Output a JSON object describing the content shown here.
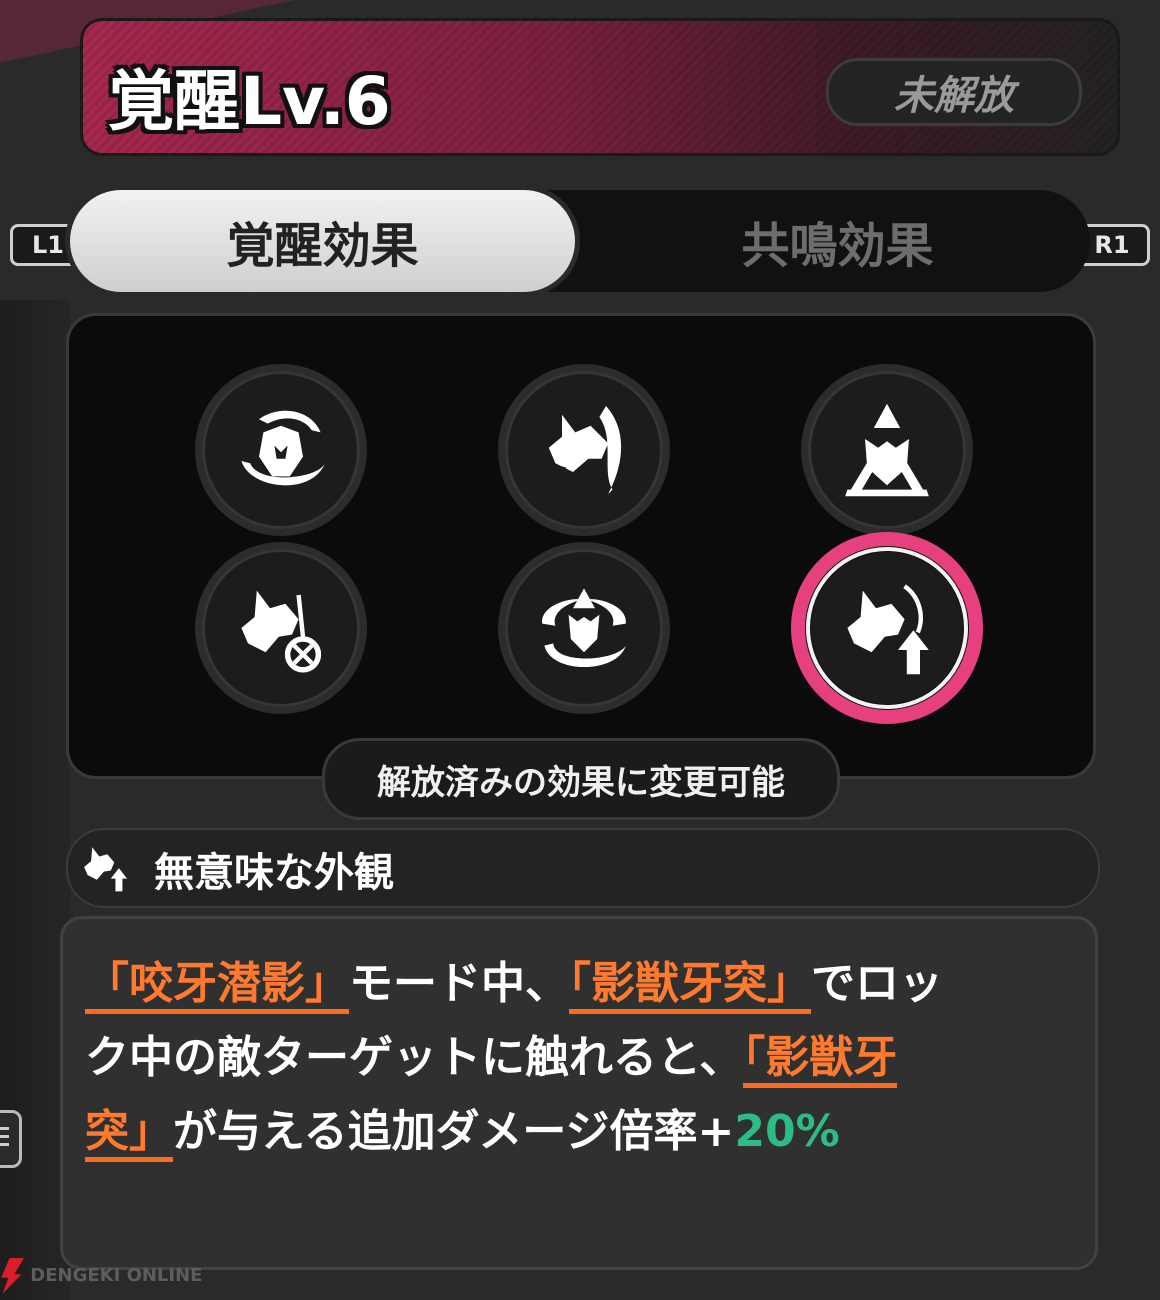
{
  "header": {
    "title": "覚醒Lv.6",
    "status": "未解放"
  },
  "tabs": [
    {
      "label": "覚醒効果",
      "active": true
    },
    {
      "label": "共鳴効果",
      "active": false
    }
  ],
  "keys": {
    "left": "L1",
    "right": "R1"
  },
  "nodes": [
    {
      "icon": "wolf-mask-orbit-icon"
    },
    {
      "icon": "wolf-head-claw-icon"
    },
    {
      "icon": "wolf-triangle-icon"
    },
    {
      "icon": "wolf-target-icon"
    },
    {
      "icon": "wolf-vortex-icon"
    },
    {
      "icon": "wolf-arrow-up-icon",
      "selected": true
    }
  ],
  "hint": "解放済みの効果に変更可能",
  "effect": {
    "name": "無意味な外観",
    "desc_parts": [
      "「咬牙潜影」",
      "モード中、",
      "「影獣牙突」",
      "でロッ",
      "ク中の敵ターゲットに触れると、",
      "「影獣牙",
      "突」",
      "が与える追加ダメージ倍率+",
      "20%"
    ]
  },
  "colors": {
    "accent": "#e6407f",
    "highlight": "#ff7a2e",
    "positive": "#2ebc86",
    "header": "#a8284f"
  },
  "watermark": "DENGEKI ONLINE"
}
